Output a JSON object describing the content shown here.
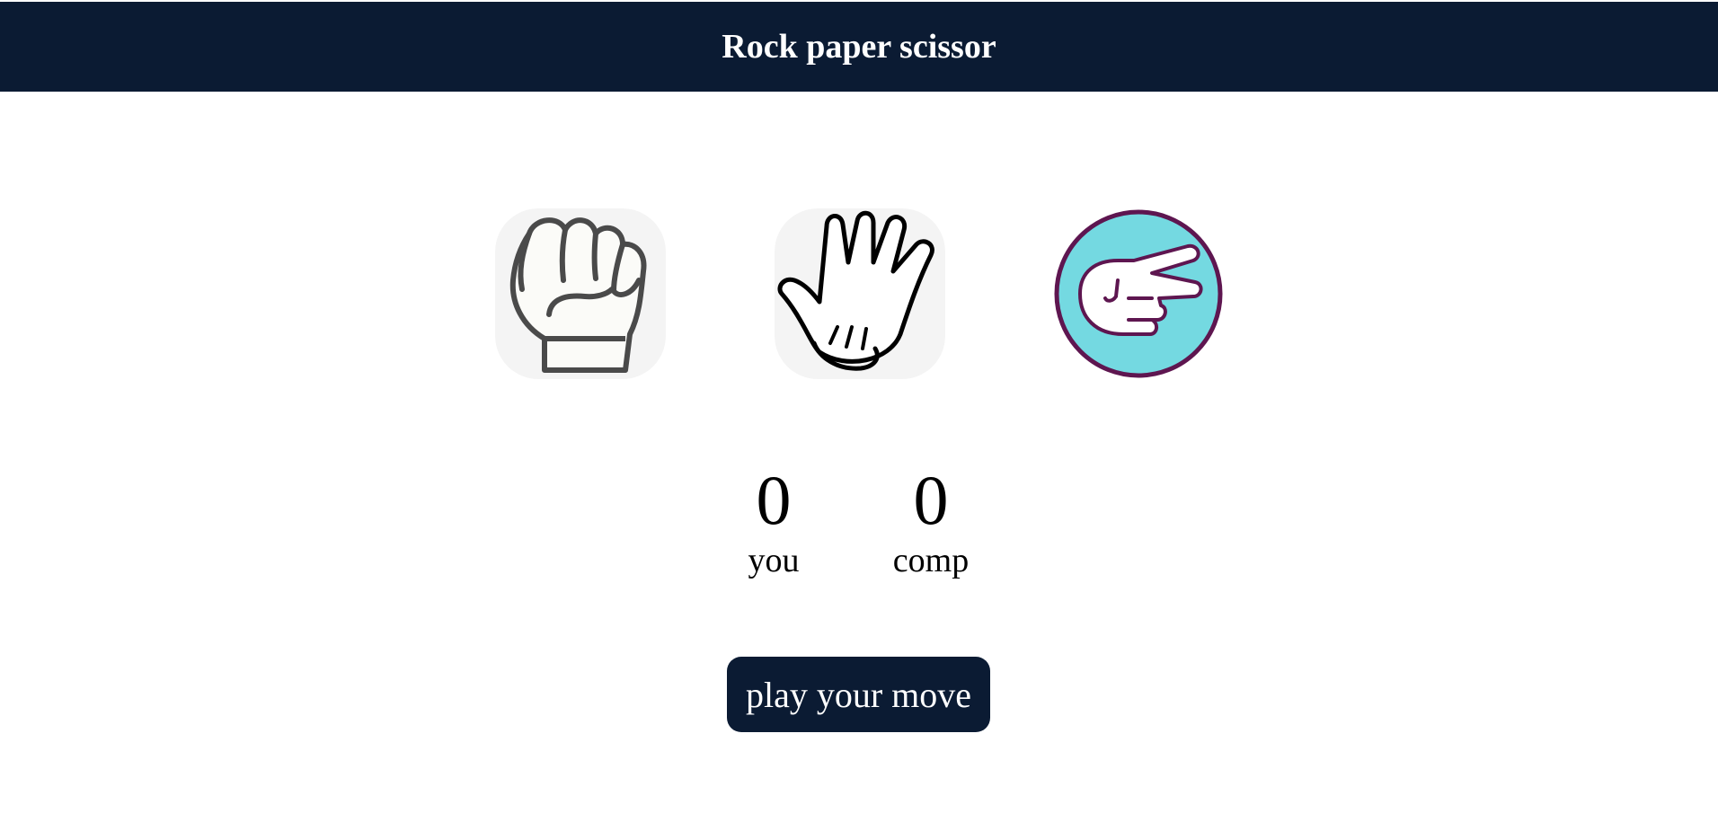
{
  "header": {
    "title": "Rock paper scissor"
  },
  "choices": [
    {
      "id": "rock",
      "icon": "rock-fist-icon"
    },
    {
      "id": "paper",
      "icon": "paper-hand-icon"
    },
    {
      "id": "scissor",
      "icon": "scissor-hand-icon"
    }
  ],
  "scoreboard": {
    "you": {
      "score": "0",
      "label": "you"
    },
    "comp": {
      "score": "0",
      "label": "comp"
    }
  },
  "message": {
    "text": "play your move"
  },
  "colors": {
    "header_bg": "#0b1b33",
    "choice_bg": "#f4f4f4",
    "scissor_bg": "#74d9e1",
    "scissor_ring": "#5e1650",
    "text": "#000000"
  }
}
